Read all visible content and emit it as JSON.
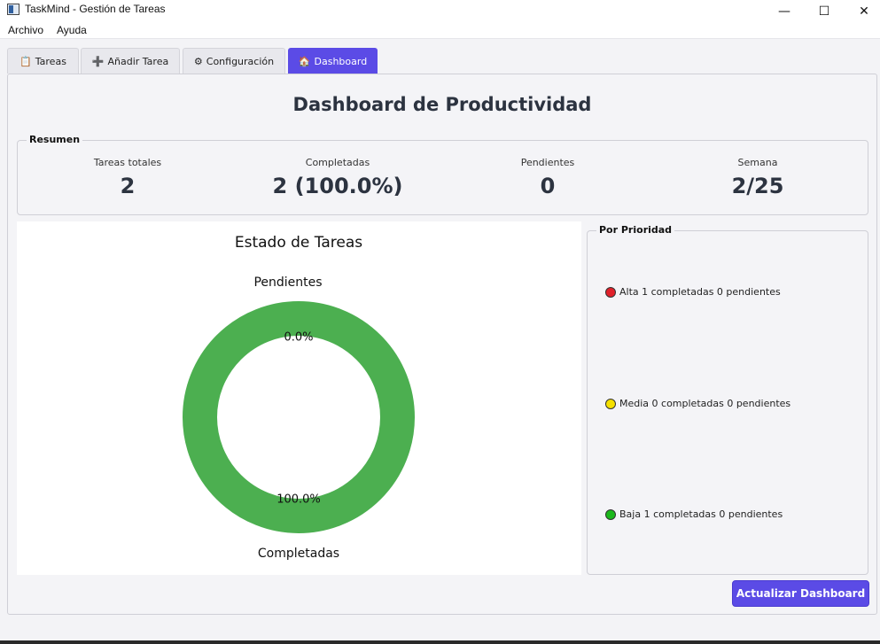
{
  "window": {
    "title": "TaskMind - Gestión de Tareas",
    "controls": {
      "minimize": "—",
      "maximize": "☐",
      "close": "✕"
    }
  },
  "menu": [
    "Archivo",
    "Ayuda"
  ],
  "tabs": [
    {
      "label": "Tareas",
      "icon": "clipboard-icon",
      "glyph": "📋",
      "active": false
    },
    {
      "label": "Añadir Tarea",
      "icon": "plus-icon",
      "glyph": "➕",
      "active": false
    },
    {
      "label": "Configuración",
      "icon": "gear-icon",
      "glyph": "⚙",
      "active": false
    },
    {
      "label": "Dashboard",
      "icon": "home-icon",
      "glyph": "🏠",
      "active": true
    }
  ],
  "dashboard": {
    "title": "Dashboard de Productividad",
    "summary": {
      "label": "Resumen",
      "stats": [
        {
          "label": "Tareas totales",
          "value": "2"
        },
        {
          "label": "Completadas",
          "value": "2 (100.0%)"
        },
        {
          "label": "Pendientes",
          "value": "0"
        },
        {
          "label": "Semana",
          "value": "2/25"
        }
      ]
    },
    "priority": {
      "label": "Por Prioridad",
      "rows": [
        {
          "text": "Alta 1 completadas  0 pendientes",
          "color": "#e0202a"
        },
        {
          "text": "Media 0 completadas  0 pendientes",
          "color": "#f5e000"
        },
        {
          "text": "Baja 1 completadas  0 pendientes",
          "color": "#1cb81c"
        }
      ]
    },
    "refresh_label": "Actualizar Dashboard"
  },
  "chart_data": {
    "type": "pie",
    "title": "Estado de Tareas",
    "style": "donut",
    "slices": [
      {
        "label": "Pendientes",
        "value": 0.0,
        "pct_label": "0.0%",
        "color": "#f44336"
      },
      {
        "label": "Completadas",
        "value": 100.0,
        "pct_label": "100.0%",
        "color": "#4caf50"
      }
    ]
  }
}
